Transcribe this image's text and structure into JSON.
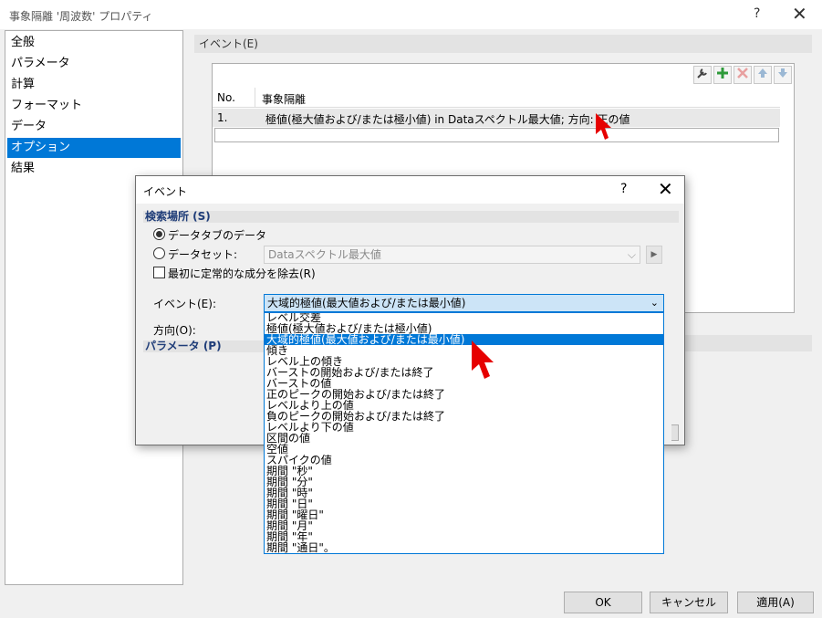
{
  "window": {
    "title": "事象隔離 '周波数' プロパティ",
    "help_glyph": "?",
    "close_glyph": "✕"
  },
  "nav": {
    "items": [
      "全般",
      "パラメータ",
      "計算",
      "フォーマット",
      "データ",
      "オプション",
      "結果"
    ],
    "selected_index": 5
  },
  "event_panel": {
    "header": "イベント(E)",
    "toolbar": [
      "wrench-icon",
      "plus-icon",
      "delete-icon",
      "move-up-icon",
      "move-down-icon"
    ],
    "table": {
      "columns": [
        "No.",
        "事象隔離"
      ],
      "rows": [
        {
          "no": "1.",
          "desc": "極値(極大値および/または極小値) in Dataスペクトル最大値; 方向: 正の値"
        }
      ]
    }
  },
  "event_dialog": {
    "title": "イベント",
    "help_glyph": "?",
    "close_glyph": "✕",
    "search_section": "検索場所 (S)",
    "radio_datatab": "データタブのデータ",
    "radio_dataset": "データセット:",
    "dataset_value": "Dataスペクトル最大値",
    "checkbox_remove_dc": "最初に定常的な成分を除去(R)",
    "event_label": "イベント(E):",
    "event_value": "大域的極値(最大値および/または最小値)",
    "direction_label": "方向(O):",
    "param_section": "パラメータ (P)",
    "event_options": [
      "レベル交差",
      "極値(極大値および/または極小値)",
      "大域的極値(最大値および/または最小値)",
      "傾き",
      "レベル上の傾き",
      "バーストの開始および/または終了",
      "バーストの値",
      "正のピークの開始および/または終了",
      "レベルより上の値",
      "負のピークの開始および/または終了",
      "レベルより下の値",
      "区間の値",
      "空値",
      "スパイクの値",
      "期間 \"秒\"",
      "期間 \"分\"",
      "期間 \"時\"",
      "期間 \"日\"",
      "期間 \"曜日\"",
      "期間 \"月\"",
      "期間 \"年\"",
      "期間 \"通日\"。"
    ],
    "selected_option_index": 2
  },
  "footer": {
    "ok": "OK",
    "cancel": "キャンセル",
    "apply": "適用(A)"
  },
  "colors": {
    "accent": "#0078d7",
    "cursor": "#e60000"
  }
}
